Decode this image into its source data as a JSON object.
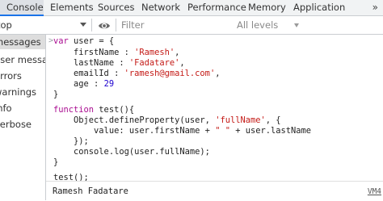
{
  "tabs": [
    {
      "label": "Console",
      "active": true
    },
    {
      "label": "Elements",
      "active": false
    },
    {
      "label": "Sources",
      "active": false
    },
    {
      "label": "Network",
      "active": false
    },
    {
      "label": "Performance",
      "active": false
    },
    {
      "label": "Memory",
      "active": false
    },
    {
      "label": "Application",
      "active": false
    }
  ],
  "more_tabs": "»",
  "toolbar": {
    "context": "top",
    "filter_placeholder": "Filter",
    "levels": "All levels"
  },
  "sidebar": {
    "items": [
      {
        "label": "messages",
        "selected": true
      },
      {
        "label": "user messages",
        "selected": false
      },
      {
        "label": "errors",
        "selected": false
      },
      {
        "label": "warnings",
        "selected": false
      },
      {
        "label": "info",
        "selected": false
      },
      {
        "label": "verbose",
        "selected": false
      }
    ]
  },
  "console": {
    "prompt": ">",
    "output_text": "Ramesh Fadatare",
    "output_source": "VM4"
  },
  "colors": {
    "accent": "#1a73e8",
    "keyword": "#aa0d91",
    "string": "#c41a16",
    "number": "#1c00cf",
    "tabbar_bg": "#f1f3f4",
    "active_tab_bg": "#dee1e6"
  },
  "icons": {
    "eye": "eye-icon",
    "context_dropdown": "caret-down-icon",
    "levels_dropdown": "caret-down-icon",
    "prompt": "chevron-right-icon"
  }
}
